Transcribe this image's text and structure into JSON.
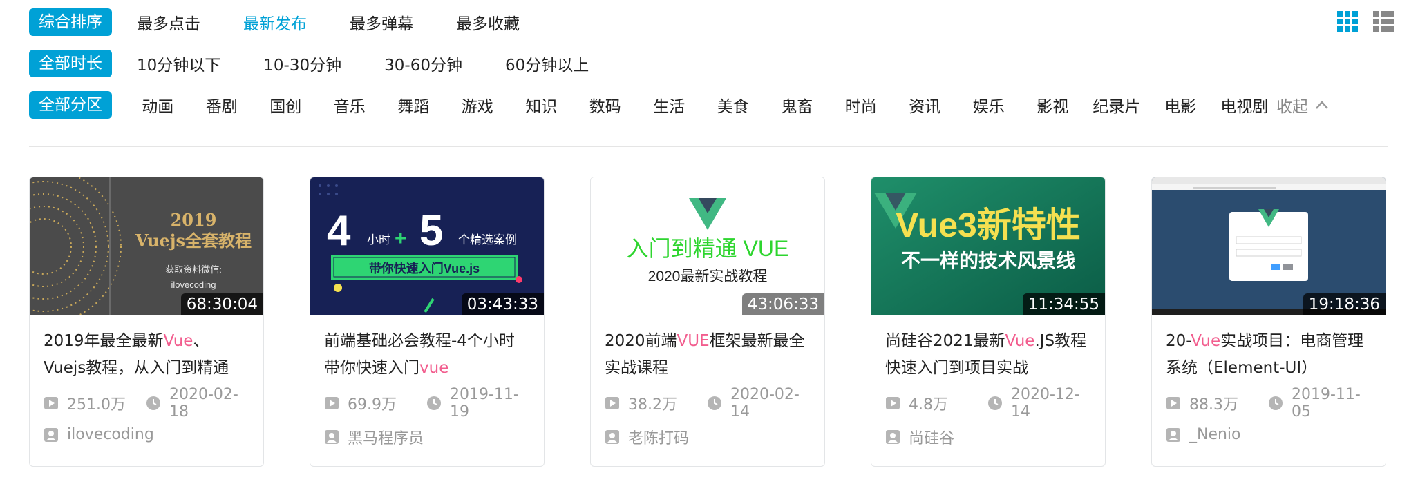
{
  "sort_filters": {
    "active": "综合排序",
    "options": [
      "最多点击",
      "最新发布",
      "最多弹幕",
      "最多收藏"
    ]
  },
  "duration_filters": {
    "active": "全部时长",
    "options": [
      "10分钟以下",
      "10-30分钟",
      "30-60分钟",
      "60分钟以上"
    ]
  },
  "zone_filters": {
    "active": "全部分区",
    "options": [
      "动画",
      "番剧",
      "国创",
      "音乐",
      "舞蹈",
      "游戏",
      "知识",
      "数码",
      "生活",
      "美食",
      "鬼畜",
      "时尚",
      "资讯",
      "娱乐",
      "影视",
      "纪录片",
      "电影",
      "电视剧"
    ],
    "collapse_label": "收起"
  },
  "view_toggle": {
    "grid_icon": "grid-icon",
    "list_icon": "list-icon"
  },
  "colors": {
    "accent": "#00a1d6",
    "highlight": "#f25d8e",
    "meta": "#999999"
  },
  "thumbnails": {
    "t1": {
      "year": "2019",
      "title": "Vuejs全套教程",
      "line1": "获取资料微信:",
      "line2": "ilovecoding"
    },
    "t2": {
      "num1": "4",
      "unit1": "小时",
      "plus": "+",
      "num2": "5",
      "unit2": "个精选案例",
      "banner": "带你快速入门Vue.js"
    },
    "t3": {
      "line1": "入门到精通 VUE",
      "line2": "2020最新实战教程"
    },
    "t4": {
      "line1": "Vue3新特性",
      "line2": "不一样的技术风景线"
    }
  },
  "videos": [
    {
      "duration": "68:30:04",
      "title_pre": "2019年最全最新",
      "title_hl": "Vue",
      "title_post": "、Vuejs教程，从入门到精通",
      "views": "251.0万",
      "date": "2020-02-18",
      "author": "ilovecoding"
    },
    {
      "duration": "03:43:33",
      "title_pre": "前端基础必会教程-4个小时带你快速入门",
      "title_hl": "vue",
      "title_post": "",
      "views": "69.9万",
      "date": "2019-11-19",
      "author": "黑马程序员"
    },
    {
      "duration": "43:06:33",
      "title_pre": "2020前端",
      "title_hl": "VUE",
      "title_post": "框架最新最全实战课程",
      "views": "38.2万",
      "date": "2020-02-14",
      "author": "老陈打码"
    },
    {
      "duration": "11:34:55",
      "title_pre": "尚硅谷2021最新",
      "title_hl": "Vue",
      "title_post": ".JS教程快速入门到项目实战",
      "views": "4.8万",
      "date": "2020-12-14",
      "author": "尚硅谷"
    },
    {
      "duration": "19:18:36",
      "title_pre": "20-",
      "title_hl": "Vue",
      "title_post": "实战项目：电商管理系统（Element-UI）",
      "views": "88.3万",
      "date": "2019-11-05",
      "author": "_Nenio"
    }
  ]
}
